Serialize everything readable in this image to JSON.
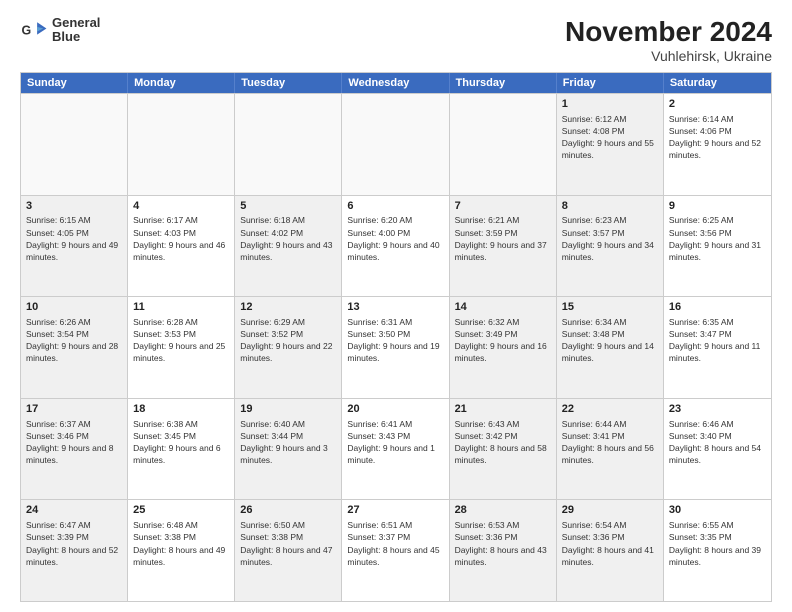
{
  "logo": {
    "line1": "General",
    "line2": "Blue"
  },
  "title": "November 2024",
  "subtitle": "Vuhlehirsk, Ukraine",
  "header_days": [
    "Sunday",
    "Monday",
    "Tuesday",
    "Wednesday",
    "Thursday",
    "Friday",
    "Saturday"
  ],
  "rows": [
    [
      {
        "day": "",
        "text": "",
        "empty": true
      },
      {
        "day": "",
        "text": "",
        "empty": true
      },
      {
        "day": "",
        "text": "",
        "empty": true
      },
      {
        "day": "",
        "text": "",
        "empty": true
      },
      {
        "day": "",
        "text": "",
        "empty": true
      },
      {
        "day": "1",
        "text": "Sunrise: 6:12 AM\nSunset: 4:08 PM\nDaylight: 9 hours and 55 minutes.",
        "shaded": true
      },
      {
        "day": "2",
        "text": "Sunrise: 6:14 AM\nSunset: 4:06 PM\nDaylight: 9 hours and 52 minutes."
      }
    ],
    [
      {
        "day": "3",
        "text": "Sunrise: 6:15 AM\nSunset: 4:05 PM\nDaylight: 9 hours and 49 minutes.",
        "shaded": true
      },
      {
        "day": "4",
        "text": "Sunrise: 6:17 AM\nSunset: 4:03 PM\nDaylight: 9 hours and 46 minutes."
      },
      {
        "day": "5",
        "text": "Sunrise: 6:18 AM\nSunset: 4:02 PM\nDaylight: 9 hours and 43 minutes.",
        "shaded": true
      },
      {
        "day": "6",
        "text": "Sunrise: 6:20 AM\nSunset: 4:00 PM\nDaylight: 9 hours and 40 minutes."
      },
      {
        "day": "7",
        "text": "Sunrise: 6:21 AM\nSunset: 3:59 PM\nDaylight: 9 hours and 37 minutes.",
        "shaded": true
      },
      {
        "day": "8",
        "text": "Sunrise: 6:23 AM\nSunset: 3:57 PM\nDaylight: 9 hours and 34 minutes.",
        "shaded": true
      },
      {
        "day": "9",
        "text": "Sunrise: 6:25 AM\nSunset: 3:56 PM\nDaylight: 9 hours and 31 minutes."
      }
    ],
    [
      {
        "day": "10",
        "text": "Sunrise: 6:26 AM\nSunset: 3:54 PM\nDaylight: 9 hours and 28 minutes.",
        "shaded": true
      },
      {
        "day": "11",
        "text": "Sunrise: 6:28 AM\nSunset: 3:53 PM\nDaylight: 9 hours and 25 minutes."
      },
      {
        "day": "12",
        "text": "Sunrise: 6:29 AM\nSunset: 3:52 PM\nDaylight: 9 hours and 22 minutes.",
        "shaded": true
      },
      {
        "day": "13",
        "text": "Sunrise: 6:31 AM\nSunset: 3:50 PM\nDaylight: 9 hours and 19 minutes."
      },
      {
        "day": "14",
        "text": "Sunrise: 6:32 AM\nSunset: 3:49 PM\nDaylight: 9 hours and 16 minutes.",
        "shaded": true
      },
      {
        "day": "15",
        "text": "Sunrise: 6:34 AM\nSunset: 3:48 PM\nDaylight: 9 hours and 14 minutes.",
        "shaded": true
      },
      {
        "day": "16",
        "text": "Sunrise: 6:35 AM\nSunset: 3:47 PM\nDaylight: 9 hours and 11 minutes."
      }
    ],
    [
      {
        "day": "17",
        "text": "Sunrise: 6:37 AM\nSunset: 3:46 PM\nDaylight: 9 hours and 8 minutes.",
        "shaded": true
      },
      {
        "day": "18",
        "text": "Sunrise: 6:38 AM\nSunset: 3:45 PM\nDaylight: 9 hours and 6 minutes."
      },
      {
        "day": "19",
        "text": "Sunrise: 6:40 AM\nSunset: 3:44 PM\nDaylight: 9 hours and 3 minutes.",
        "shaded": true
      },
      {
        "day": "20",
        "text": "Sunrise: 6:41 AM\nSunset: 3:43 PM\nDaylight: 9 hours and 1 minute."
      },
      {
        "day": "21",
        "text": "Sunrise: 6:43 AM\nSunset: 3:42 PM\nDaylight: 8 hours and 58 minutes.",
        "shaded": true
      },
      {
        "day": "22",
        "text": "Sunrise: 6:44 AM\nSunset: 3:41 PM\nDaylight: 8 hours and 56 minutes.",
        "shaded": true
      },
      {
        "day": "23",
        "text": "Sunrise: 6:46 AM\nSunset: 3:40 PM\nDaylight: 8 hours and 54 minutes."
      }
    ],
    [
      {
        "day": "24",
        "text": "Sunrise: 6:47 AM\nSunset: 3:39 PM\nDaylight: 8 hours and 52 minutes.",
        "shaded": true
      },
      {
        "day": "25",
        "text": "Sunrise: 6:48 AM\nSunset: 3:38 PM\nDaylight: 8 hours and 49 minutes."
      },
      {
        "day": "26",
        "text": "Sunrise: 6:50 AM\nSunset: 3:38 PM\nDaylight: 8 hours and 47 minutes.",
        "shaded": true
      },
      {
        "day": "27",
        "text": "Sunrise: 6:51 AM\nSunset: 3:37 PM\nDaylight: 8 hours and 45 minutes."
      },
      {
        "day": "28",
        "text": "Sunrise: 6:53 AM\nSunset: 3:36 PM\nDaylight: 8 hours and 43 minutes.",
        "shaded": true
      },
      {
        "day": "29",
        "text": "Sunrise: 6:54 AM\nSunset: 3:36 PM\nDaylight: 8 hours and 41 minutes.",
        "shaded": true
      },
      {
        "day": "30",
        "text": "Sunrise: 6:55 AM\nSunset: 3:35 PM\nDaylight: 8 hours and 39 minutes."
      }
    ]
  ]
}
